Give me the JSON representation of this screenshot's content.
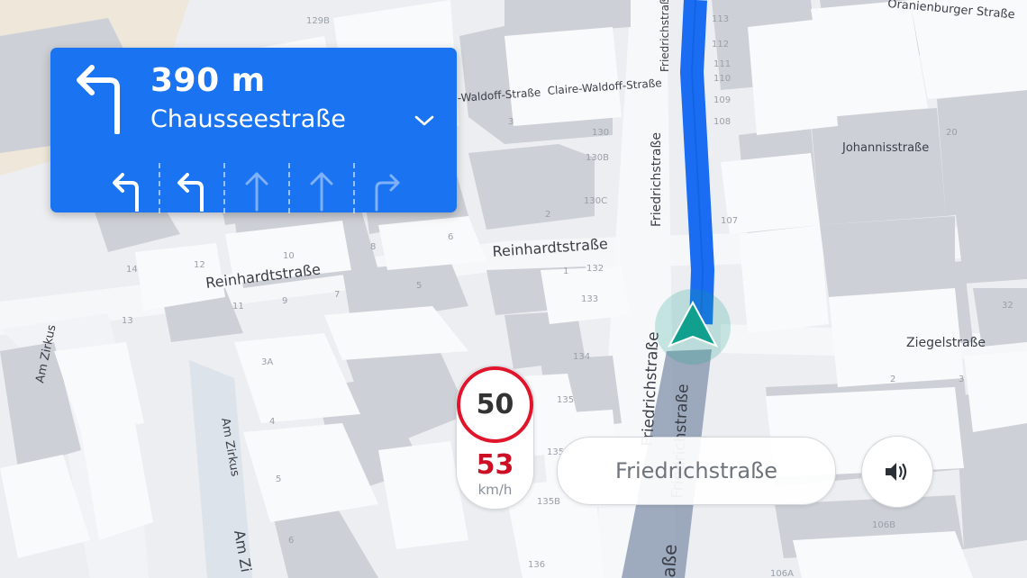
{
  "maneuver": {
    "distance": "390 m",
    "street": "Chausseestraße",
    "lanes": [
      {
        "direction": "left",
        "active": true
      },
      {
        "direction": "left",
        "active": true
      },
      {
        "direction": "straight",
        "active": false
      },
      {
        "direction": "straight",
        "active": false
      },
      {
        "direction": "right",
        "active": false
      }
    ]
  },
  "speed": {
    "limit": "50",
    "current": "53",
    "unit": "km/h"
  },
  "current_street": "Friedrichstraße",
  "map": {
    "streets": {
      "oranienburger": "Oranienburger Straße",
      "claire_waldoff_1": "-Waldoff-Straße",
      "claire_waldoff_2": "Claire-Waldoff-Straße",
      "friedrich_top": "Friedrichstraße",
      "friedrich_mid": "Friedrichstraße",
      "johannis": "Johannisstraße",
      "reinhardt_1": "Reinhardtstraße",
      "reinhardt_2": "Reinhardtstraße",
      "ziegel": "Ziegelstraße",
      "am_zirkus_1": "Am Zirkus",
      "am_zirkus_2": "Am Zirkus",
      "am_zirkus_3": "Am Zi",
      "friedrich_a": "Friedrichstraße",
      "friedrich_b": "Friedrichstraße",
      "friedrich_c": "aße"
    },
    "house_numbers": {
      "n129b": "129B",
      "n130": "130",
      "n130b": "130B",
      "n130c": "130C",
      "n3": "3",
      "n2": "2",
      "n1": "1",
      "n132": "132",
      "n133": "133",
      "n134": "134",
      "n135": "135",
      "n135a": "135A",
      "n135b": "135B",
      "n136": "136",
      "n12": "12",
      "n10": "10",
      "n8": "8",
      "n6": "6",
      "n9": "9",
      "n7": "7",
      "n5": "5",
      "n14": "14",
      "n13": "13",
      "n11": "11",
      "n3a": "3A",
      "n4": "4",
      "n5b": "5",
      "n6b": "6",
      "n20": "20",
      "n32": "32",
      "n2b": "2",
      "n3b": "3",
      "n106a": "106A",
      "n106b": "106B",
      "n107": "107",
      "n108": "108",
      "n109": "109",
      "n112": "112",
      "n111": "111",
      "n110": "110",
      "n113": "113"
    },
    "colors": {
      "route": "#1a6df2",
      "route_driven": "#8e9cb3",
      "position_marker": "#12a08e",
      "speed_limit_ring": "#e0152b",
      "speeding": "#cc0f24",
      "panel": "#1a73f0"
    }
  },
  "icons": {
    "turn": "turn-left-icon",
    "expand": "chevron-down-icon",
    "position": "navigation-arrow-icon",
    "sound": "speaker-icon"
  }
}
